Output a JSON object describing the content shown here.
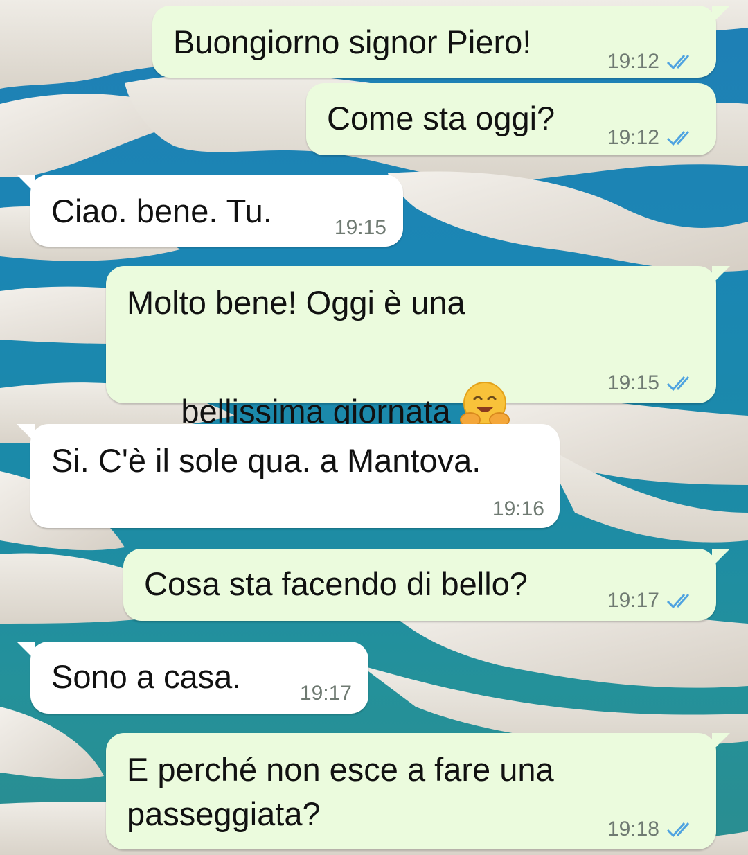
{
  "messages": [
    {
      "direction": "out",
      "lines": [
        "Buongiorno signor Piero!"
      ],
      "time": "19:12",
      "status": "read"
    },
    {
      "direction": "out",
      "lines": [
        "Come sta oggi?"
      ],
      "time": "19:12",
      "status": "read"
    },
    {
      "direction": "in",
      "lines": [
        "Ciao. bene. Tu."
      ],
      "time": "19:15"
    },
    {
      "direction": "out",
      "lines": [
        "Molto bene! Oggi è una",
        "bellissima giornata"
      ],
      "emoji": "hugging-face",
      "time": "19:15",
      "status": "read"
    },
    {
      "direction": "in",
      "lines": [
        "Si. C'è il sole qua. a Mantova."
      ],
      "time": "19:16"
    },
    {
      "direction": "out",
      "lines": [
        "Cosa sta facendo di bello?"
      ],
      "time": "19:17",
      "status": "read"
    },
    {
      "direction": "in",
      "lines": [
        "Sono a casa."
      ],
      "time": "19:17"
    },
    {
      "direction": "out",
      "lines": [
        "E perché non esce a fare una",
        "passeggiata?"
      ],
      "time": "19:18",
      "status": "read"
    }
  ],
  "colors": {
    "outgoing_bubble": "#ebfbdd",
    "incoming_bubble": "#ffffff",
    "read_ticks": "#4fa3e0",
    "time_text": "#6f7a72"
  },
  "icons": {
    "read_receipt": "double-check-icon",
    "wallpaper": "sand-dunes-lagoons"
  }
}
